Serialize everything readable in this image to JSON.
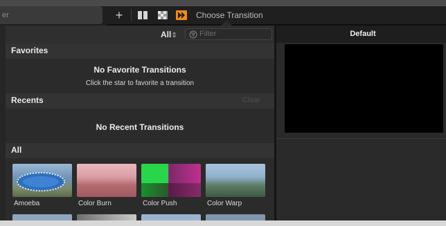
{
  "toolbar": {
    "search_fragment": "er",
    "add_icon": "plus-icon",
    "title": "Choose Transition"
  },
  "browser": {
    "filter_select": "All",
    "filter_placeholder": "Filter",
    "sections": {
      "favorites": {
        "label": "Favorites",
        "empty_title": "No Favorite Transitions",
        "empty_hint": "Click the star to favorite a transition"
      },
      "recents": {
        "label": "Recents",
        "clear_label": "Clear",
        "empty_title": "No Recent Transitions"
      },
      "all": {
        "label": "All",
        "items": [
          {
            "name": "Amoeba"
          },
          {
            "name": "Color Burn"
          },
          {
            "name": "Color Push"
          },
          {
            "name": "Color Warp"
          }
        ]
      }
    }
  },
  "viewer": {
    "title": "Default"
  },
  "colors": {
    "accent_orange": "#f08a1c",
    "panel_bg": "#2b2b2b",
    "toolbar_bg": "#1f1f1f"
  }
}
